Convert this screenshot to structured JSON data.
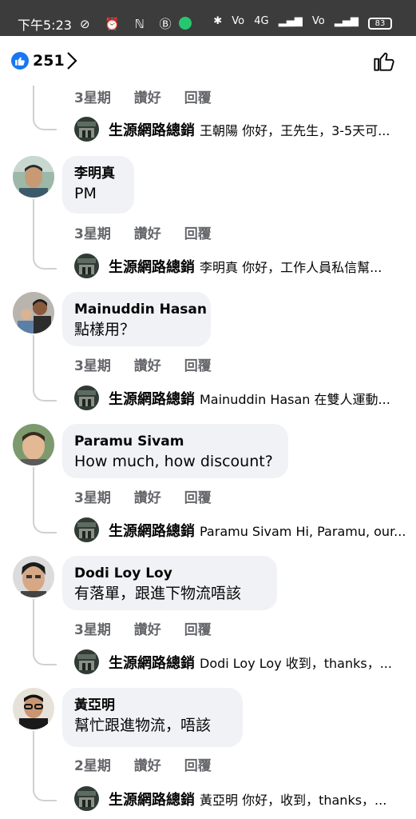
{
  "status_bar": {
    "time": "下午5:23",
    "icons_left": "⊘ ⏰ ℕ Ⓑ",
    "volte1": "Vo",
    "net": "4G",
    "volte2": "Vo",
    "battery": "83"
  },
  "header": {
    "like_count": "251",
    "accent_color": "#1877f2"
  },
  "comments": [
    {
      "author": "",
      "text": "",
      "time": "3星期",
      "like_label": "讚好",
      "reply_label": "回覆",
      "reply": {
        "author": "生源網路總銷",
        "text": "王朝陽 你好，王先生，3-5天可..."
      }
    },
    {
      "author": "李明真",
      "text": "PM",
      "time": "3星期",
      "like_label": "讚好",
      "reply_label": "回覆",
      "reply": {
        "author": "生源網路總銷",
        "text": "李明真 你好，工作人員私信幫..."
      }
    },
    {
      "author": "Mainuddin Hasan",
      "text": "點樣用？",
      "time": "3星期",
      "like_label": "讚好",
      "reply_label": "回覆",
      "reply": {
        "author": "生源網路總銷",
        "text": "Mainuddin Hasan 在雙人運動..."
      }
    },
    {
      "author": "Paramu Sivam",
      "text": "How much, how discount?",
      "time": "3星期",
      "like_label": "讚好",
      "reply_label": "回覆",
      "reply": {
        "author": "生源網路總銷",
        "text": "Paramu Sivam Hi, Paramu, our..."
      }
    },
    {
      "author": "Dodi Loy Loy",
      "text": "有落單，跟進下物流唔該",
      "time": "3星期",
      "like_label": "讚好",
      "reply_label": "回覆",
      "reply": {
        "author": "生源網路總銷",
        "text": "Dodi Loy Loy 收到，thanks，..."
      }
    },
    {
      "author": "黃亞明",
      "text": "幫忙跟進物流，唔該",
      "time": "2星期",
      "like_label": "讚好",
      "reply_label": "回覆",
      "reply": {
        "author": "生源網路總銷",
        "text": "黃亞明 你好，收到，thanks，..."
      }
    }
  ]
}
